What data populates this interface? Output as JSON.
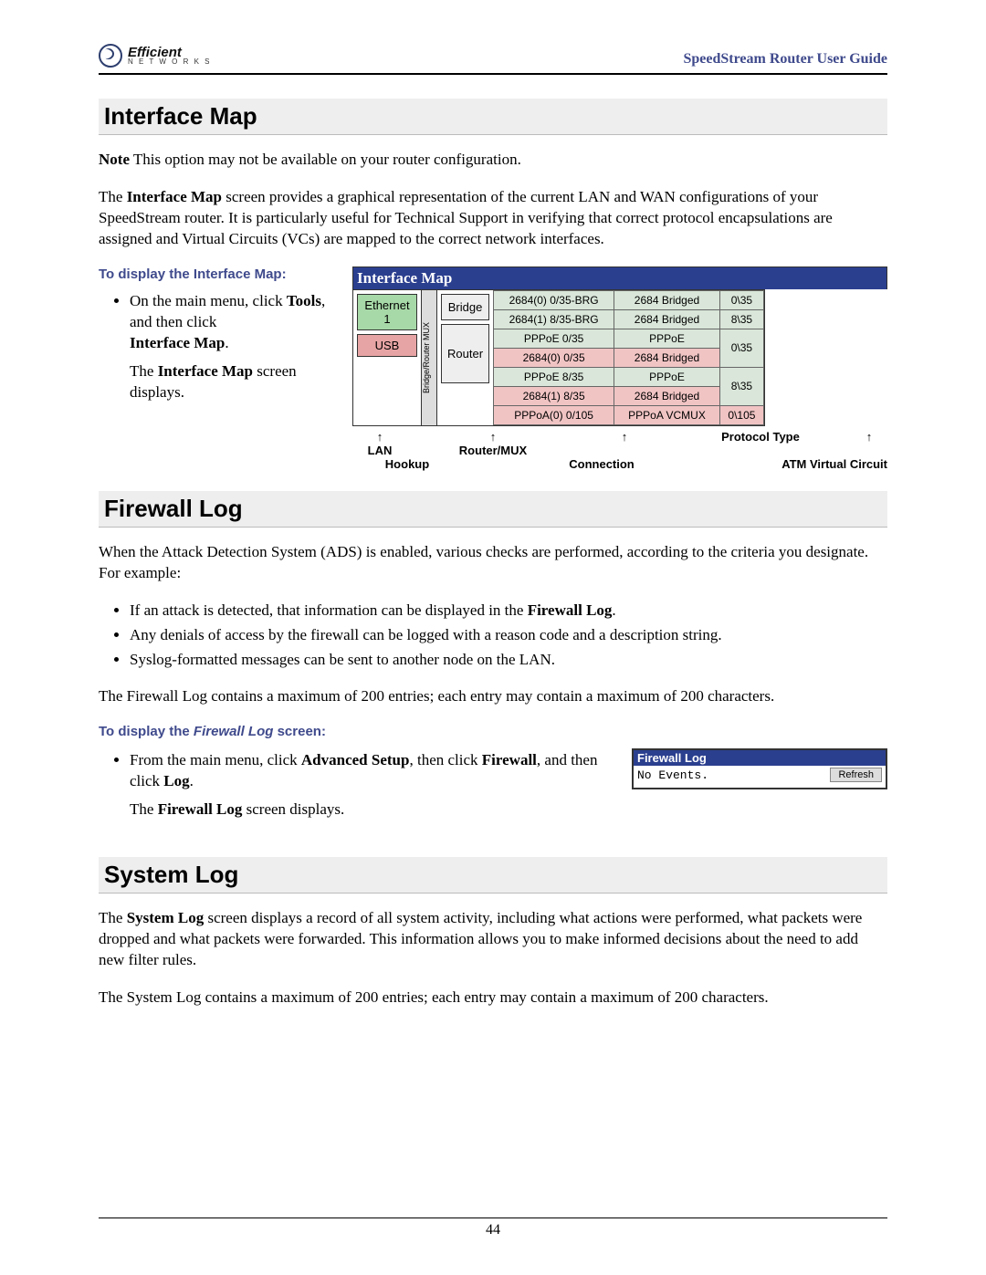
{
  "header": {
    "logo_main": "Efficient",
    "logo_sub": "N E T W O R K S",
    "doc_title": "SpeedStream Router User Guide"
  },
  "section1": {
    "title": "Interface Map",
    "note_label": "Note",
    "note_text": "  This option may not be available on your router configuration.",
    "intro": "The Interface Map screen provides a graphical representation of the current LAN and WAN configurations of your SpeedStream router. It is particularly useful for Technical Support in verifying that correct protocol encapsulations are assigned and Virtual Circuits (VCs) are mapped to the correct network interfaces.",
    "howto_head": "To display the Interface Map:",
    "howto_step_a": "On the main menu, click ",
    "howto_step_b": "Tools",
    "howto_step_c": ", and then click",
    "howto_step_d": "Interface Map",
    "howto_step_e": ".",
    "howto_result_a": "The ",
    "howto_result_b": "Interface Map",
    "howto_result_c": " screen displays."
  },
  "ifmap": {
    "title": "Interface Map",
    "eth": "Ethernet\n1",
    "usb": "USB",
    "mux": "Bridge/Router MUX",
    "bridge": "Bridge",
    "router": "Router",
    "rows": [
      {
        "cls": "grn",
        "conn": "2684(0) 0/35-BRG",
        "proto": "2684 Bridged",
        "vc": "0\\35"
      },
      {
        "cls": "grn",
        "conn": "2684(1) 8/35-BRG",
        "proto": "2684 Bridged",
        "vc": "8\\35"
      },
      {
        "cls": "grn",
        "conn": "PPPoE 0/35",
        "proto": "PPPoE",
        "vc": "0\\35"
      },
      {
        "cls": "red",
        "conn": "2684(0) 0/35",
        "proto": "2684 Bridged",
        "vc": ""
      },
      {
        "cls": "grn",
        "conn": "PPPoE 8/35",
        "proto": "PPPoE",
        "vc": "8\\35"
      },
      {
        "cls": "red",
        "conn": "2684(1) 8/35",
        "proto": "2684 Bridged",
        "vc": ""
      },
      {
        "cls": "red",
        "conn": "PPPoA(0) 0/105",
        "proto": "PPPoA VCMUX",
        "vc": "0\\105"
      }
    ],
    "labels": {
      "lan": "LAN",
      "routermux": "Router/MUX",
      "proto_type": "Protocol Type",
      "hookup": "Hookup",
      "connection": "Connection",
      "atm": "ATM Virtual Circuit"
    }
  },
  "section2": {
    "title": "Firewall Log",
    "intro": "When the Attack Detection System (ADS) is enabled, various checks are performed, according to the criteria you designate. For example:",
    "bullets": [
      {
        "pre": "If an attack is detected, that information can be displayed in the ",
        "bold": "Firewall Log",
        "post": "."
      },
      {
        "pre": "Any denials of access by the firewall can be logged with a reason code and a description string.",
        "bold": "",
        "post": ""
      },
      {
        "pre": "Syslog-formatted messages can be sent to another node on the LAN.",
        "bold": "",
        "post": ""
      }
    ],
    "limits": "The Firewall Log contains a maximum of 200 entries; each entry may contain a maximum of 200 characters.",
    "howto_head_a": "To display the ",
    "howto_head_b": "Firewall Log",
    "howto_head_c": " screen:",
    "step_a": "From the main menu, click ",
    "step_b": "Advanced Setup",
    "step_c": ", then click ",
    "step_d": "Firewall",
    "step_e": ", and then click ",
    "step_f": "Log",
    "step_g": ".",
    "result_a": "The ",
    "result_b": "Firewall Log",
    "result_c": " screen displays."
  },
  "fwbox": {
    "title": "Firewall Log",
    "body": "No Events.",
    "refresh": "Refresh"
  },
  "section3": {
    "title": "System Log",
    "p1_a": "The ",
    "p1_b": "System Log",
    "p1_c": " screen displays a record of all system activity, including what actions were performed, what packets were dropped and what packets were forwarded. This information allows you to make informed decisions about the need to add new filter rules.",
    "p2": "The System Log contains a maximum of 200 entries; each entry may contain a maximum of 200 characters."
  },
  "page_number": "44"
}
